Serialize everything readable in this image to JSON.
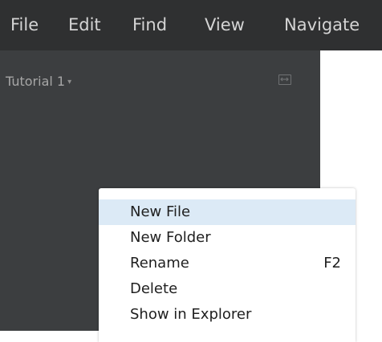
{
  "menubar": {
    "items": [
      {
        "label": "File"
      },
      {
        "label": "Edit"
      },
      {
        "label": "Find"
      },
      {
        "label": "View"
      },
      {
        "label": "Navigate"
      }
    ]
  },
  "sidebar": {
    "project_title": "Tutorial 1",
    "project_caret": "▾"
  },
  "context_menu": {
    "items": [
      {
        "label": "New File",
        "shortcut": "",
        "highlighted": true
      },
      {
        "label": "New Folder",
        "shortcut": ""
      },
      {
        "label": "Rename",
        "shortcut": "F2"
      },
      {
        "label": "Delete",
        "shortcut": ""
      },
      {
        "label": "Show in Explorer",
        "shortcut": ""
      }
    ]
  },
  "colors": {
    "menubar_bg": "#2f3031",
    "sidebar_bg": "#3c3e40",
    "menu_text": "#d4d4d4",
    "highlight": "#dceaf6"
  },
  "icons": {
    "collapse": "collapse-sidebar-icon",
    "dropdown": "chevron-down-icon"
  }
}
